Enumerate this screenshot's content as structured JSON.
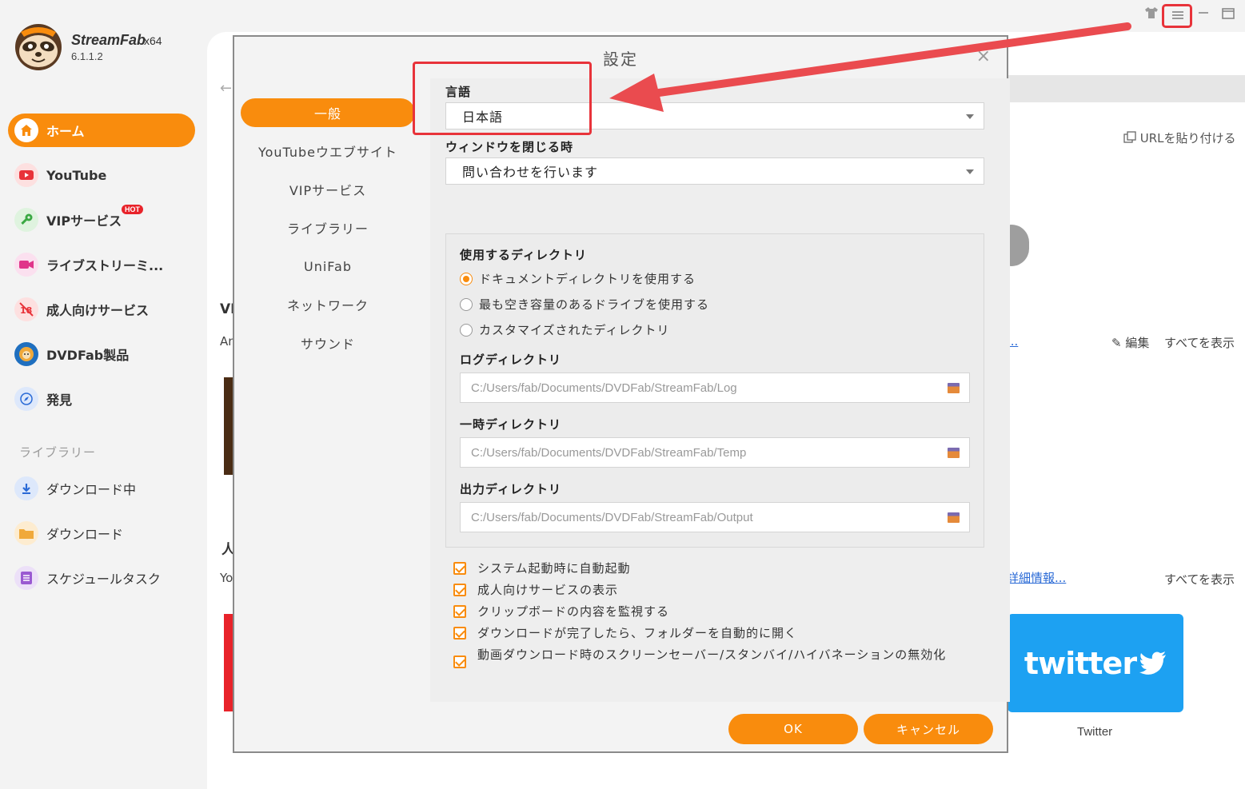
{
  "app": {
    "name": "StreamFab",
    "arch": "x64",
    "version": "6.1.1.2"
  },
  "sidebar": {
    "items": [
      {
        "label": "ホーム",
        "icon": "home-icon",
        "active": true
      },
      {
        "label": "YouTube",
        "icon": "youtube-icon"
      },
      {
        "label": "VIPサービス",
        "icon": "key-icon",
        "badge": "HOT"
      },
      {
        "label": "ライブストリーミ...",
        "icon": "live-camera-icon"
      },
      {
        "label": "成人向けサービス",
        "icon": "adult-icon"
      },
      {
        "label": "DVDFab製品",
        "icon": "dvdfab-icon"
      },
      {
        "label": "発見",
        "icon": "compass-icon"
      }
    ],
    "library_heading": "ライブラリー",
    "library_items": [
      {
        "label": "ダウンロード中",
        "icon": "download-icon"
      },
      {
        "label": "ダウンロード",
        "icon": "folder-icon"
      },
      {
        "label": "スケジュールタスク",
        "icon": "schedule-icon"
      }
    ]
  },
  "background": {
    "url_paste": "URLを貼り付ける",
    "edit": "編集",
    "show_all_1": "すべてを表示",
    "show_all_2": "すべてを表示",
    "link_more": "...",
    "link_details": "詳細情報...",
    "frag_vi": "VI",
    "frag_an": "An",
    "frag_jin": "人",
    "frag_yo": "Yo",
    "twitter_logo": "twitter",
    "twitter_caption": "Twitter"
  },
  "dialog": {
    "title": "設定",
    "close": "×",
    "nav": [
      {
        "label": "一般",
        "active": true
      },
      {
        "label": "YouTubeウエブサイト"
      },
      {
        "label": "VIPサービス"
      },
      {
        "label": "ライブラリー"
      },
      {
        "label": "UniFab"
      },
      {
        "label": "ネットワーク"
      },
      {
        "label": "サウンド"
      }
    ],
    "language": {
      "label": "言語",
      "value": "日本語"
    },
    "on_close": {
      "label": "ウィンドウを閉じる時",
      "value": "問い合わせを行います"
    },
    "directory": {
      "label": "使用するディレクトリ",
      "options": [
        {
          "label": "ドキュメントディレクトリを使用する",
          "checked": true
        },
        {
          "label": "最も空き容量のあるドライブを使用する",
          "checked": false
        },
        {
          "label": "カスタマイズされたディレクトリ",
          "checked": false
        }
      ],
      "log_label": "ログディレクトリ",
      "log_path": "C:/Users/fab/Documents/DVDFab/StreamFab/Log",
      "temp_label": "一時ディレクトリ",
      "temp_path": "C:/Users/fab/Documents/DVDFab/StreamFab/Temp",
      "output_label": "出力ディレクトリ",
      "output_path": "C:/Users/fab/Documents/DVDFab/StreamFab/Output"
    },
    "checkboxes": [
      {
        "label": "システム起動時に自動起動",
        "checked": true
      },
      {
        "label": "成人向けサービスの表示",
        "checked": true
      },
      {
        "label": "クリップボードの内容を監視する",
        "checked": true
      },
      {
        "label": "ダウンロードが完了したら、フォルダーを自動的に開く",
        "checked": true
      },
      {
        "label": "動画ダウンロード時のスクリーンセーバー/スタンバイ/ハイバネーションの無効化",
        "checked": true
      }
    ],
    "ok": "OK",
    "cancel": "キャンセル"
  },
  "colors": {
    "accent": "#f98c0d",
    "highlight": "#e8333a",
    "twitter": "#1da1f2"
  }
}
